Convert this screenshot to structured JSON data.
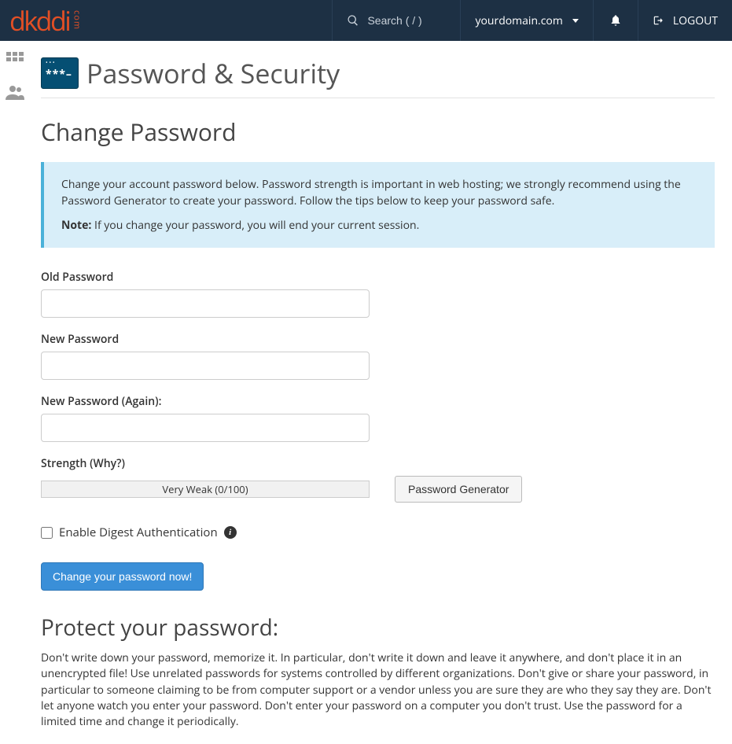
{
  "brand": {
    "name": "dkddi",
    "suffix": "com"
  },
  "topbar": {
    "search_placeholder": "Search ( / )",
    "domain": "yourdomain.com",
    "logout": "LOGOUT"
  },
  "page": {
    "title": "Password & Security",
    "section": "Change Password"
  },
  "info": {
    "para1": "Change your account password below. Password strength is important in web hosting; we strongly recommend using the Password Generator to create your password. Follow the tips below to keep your password safe.",
    "note_label": "Note:",
    "note_text": "If you change your password, you will end your current session."
  },
  "form": {
    "old_pw_label": "Old Password",
    "new_pw_label": "New Password",
    "new_pw2_label": "New Password (Again):",
    "strength_label": "Strength (Why?)",
    "strength_value": "Very Weak (0/100)",
    "gen_button": "Password Generator",
    "digest_label": "Enable Digest Authentication",
    "submit": "Change your password now!"
  },
  "protect": {
    "heading": "Protect your password:",
    "text": "Don't write down your password, memorize it. In particular, don't write it down and leave it anywhere, and don't place it in an unencrypted file! Use unrelated passwords for systems controlled by different organizations. Don't give or share your password, in particular to someone claiming to be from computer support or a vendor unless you are sure they are who they say they are. Don't let anyone watch you enter your password. Don't enter your password on a computer you don't trust. Use the password for a limited time and change it periodically."
  }
}
